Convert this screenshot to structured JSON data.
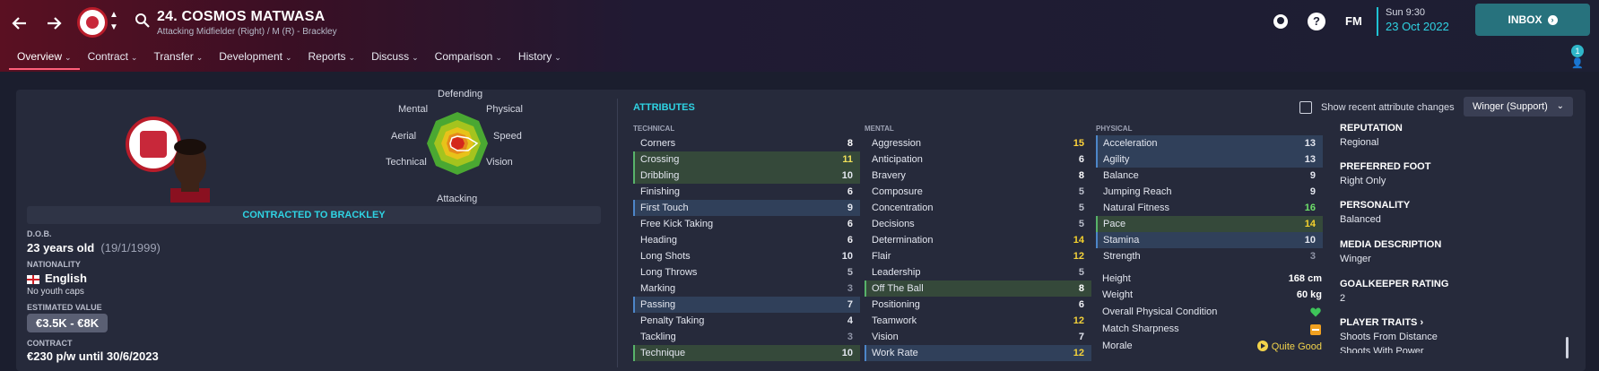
{
  "header": {
    "back_icon": "arrow-left-icon",
    "forward_icon": "arrow-right-icon",
    "player_title": "24. COSMOS MATWASA",
    "player_subtitle": "Attacking Midfielder (Right) / M (R) - Brackley",
    "fm_logo": "FM",
    "date_line1": "Sun 9:30",
    "date_line2": "23 Oct 2022",
    "inbox_label": "INBOX",
    "notification_count": "1"
  },
  "menu": [
    {
      "label": "Overview"
    },
    {
      "label": "Contract"
    },
    {
      "label": "Transfer"
    },
    {
      "label": "Development"
    },
    {
      "label": "Reports"
    },
    {
      "label": "Discuss"
    },
    {
      "label": "Comparison"
    },
    {
      "label": "History"
    }
  ],
  "radar": {
    "labels": {
      "defending": "Defending",
      "physical": "Physical",
      "speed": "Speed",
      "vision": "Vision",
      "attacking": "Attacking",
      "technical": "Technical",
      "aerial": "Aerial",
      "mental": "Mental"
    }
  },
  "profile": {
    "contract_banner": "CONTRACTED TO BRACKLEY",
    "dob_label": "D.O.B.",
    "dob_age": "23 years old",
    "dob_date": "(19/1/1999)",
    "nationality_label": "NATIONALITY",
    "nationality": "English",
    "youth_caps": "No youth caps",
    "value_label": "ESTIMATED VALUE",
    "value": "€3.5K - €8K",
    "contract_label": "CONTRACT",
    "contract": "€230 p/w until 30/6/2023"
  },
  "attributes": {
    "title": "ATTRIBUTES",
    "show_recent_label": "Show recent attribute changes",
    "role": "Winger (Support)",
    "technical_label": "TECHNICAL",
    "mental_label": "MENTAL",
    "physical_label": "PHYSICAL",
    "technical": [
      {
        "name": "Corners",
        "value": "8",
        "hl": ""
      },
      {
        "name": "Crossing",
        "value": "11",
        "hl": "green"
      },
      {
        "name": "Dribbling",
        "value": "10",
        "hl": "green"
      },
      {
        "name": "Finishing",
        "value": "6",
        "hl": ""
      },
      {
        "name": "First Touch",
        "value": "9",
        "hl": "blue"
      },
      {
        "name": "Free Kick Taking",
        "value": "6",
        "hl": ""
      },
      {
        "name": "Heading",
        "value": "6",
        "hl": ""
      },
      {
        "name": "Long Shots",
        "value": "10",
        "hl": ""
      },
      {
        "name": "Long Throws",
        "value": "5",
        "hl": ""
      },
      {
        "name": "Marking",
        "value": "3",
        "hl": ""
      },
      {
        "name": "Passing",
        "value": "7",
        "hl": "blue"
      },
      {
        "name": "Penalty Taking",
        "value": "4",
        "hl": ""
      },
      {
        "name": "Tackling",
        "value": "3",
        "hl": ""
      },
      {
        "name": "Technique",
        "value": "10",
        "hl": "green"
      }
    ],
    "mental": [
      {
        "name": "Aggression",
        "value": "15",
        "hl": ""
      },
      {
        "name": "Anticipation",
        "value": "6",
        "hl": ""
      },
      {
        "name": "Bravery",
        "value": "8",
        "hl": ""
      },
      {
        "name": "Composure",
        "value": "5",
        "hl": ""
      },
      {
        "name": "Concentration",
        "value": "5",
        "hl": ""
      },
      {
        "name": "Decisions",
        "value": "5",
        "hl": ""
      },
      {
        "name": "Determination",
        "value": "14",
        "hl": ""
      },
      {
        "name": "Flair",
        "value": "12",
        "hl": ""
      },
      {
        "name": "Leadership",
        "value": "5",
        "hl": ""
      },
      {
        "name": "Off The Ball",
        "value": "8",
        "hl": "green"
      },
      {
        "name": "Positioning",
        "value": "6",
        "hl": ""
      },
      {
        "name": "Teamwork",
        "value": "12",
        "hl": ""
      },
      {
        "name": "Vision",
        "value": "7",
        "hl": ""
      },
      {
        "name": "Work Rate",
        "value": "12",
        "hl": "blue"
      }
    ],
    "physical": [
      {
        "name": "Acceleration",
        "value": "13",
        "hl": "blue"
      },
      {
        "name": "Agility",
        "value": "13",
        "hl": "blue"
      },
      {
        "name": "Balance",
        "value": "9",
        "hl": ""
      },
      {
        "name": "Jumping Reach",
        "value": "9",
        "hl": ""
      },
      {
        "name": "Natural Fitness",
        "value": "16",
        "hl": ""
      },
      {
        "name": "Pace",
        "value": "14",
        "hl": "green"
      },
      {
        "name": "Stamina",
        "value": "10",
        "hl": "blue"
      },
      {
        "name": "Strength",
        "value": "3",
        "hl": ""
      }
    ],
    "height_label": "Height",
    "height": "168 cm",
    "weight_label": "Weight",
    "weight": "60 kg",
    "condition_label": "Overall Physical Condition",
    "sharpness_label": "Match Sharpness",
    "morale_label": "Morale",
    "morale": "Quite Good"
  },
  "info": {
    "reputation_label": "REPUTATION",
    "reputation": "Regional",
    "foot_label": "PREFERRED FOOT",
    "foot": "Right Only",
    "personality_label": "PERSONALITY",
    "personality": "Balanced",
    "media_label": "MEDIA DESCRIPTION",
    "media": "Winger",
    "gk_label": "GOALKEEPER RATING",
    "gk": "2",
    "traits_label": "PLAYER TRAITS",
    "traits": [
      "Shoots From Distance",
      "Shoots With Power"
    ]
  },
  "colors": {
    "accent": "#2fd3e3",
    "inbox": "#27727d",
    "highlight_green": "#35493a",
    "highlight_blue": "#30405a"
  }
}
